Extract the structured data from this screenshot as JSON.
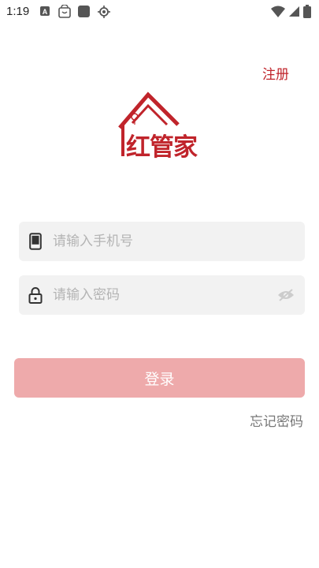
{
  "status_bar": {
    "time": "1:19",
    "icons": [
      "a-notification-icon",
      "bag-notification-icon",
      "square-notification-icon",
      "location-icon",
      "wifi-icon",
      "signal-icon",
      "battery-icon"
    ]
  },
  "header": {
    "register_label": "注册"
  },
  "logo": {
    "text": "红管家",
    "color": "#c0242b"
  },
  "form": {
    "phone": {
      "placeholder": "请输入手机号",
      "value": ""
    },
    "password": {
      "placeholder": "请输入密码",
      "value": ""
    },
    "login_label": "登录",
    "forgot_label": "忘记密码"
  },
  "colors": {
    "brand": "#c0242b",
    "button_disabled": "#eeaaab",
    "field_bg": "#f2f2f2"
  }
}
